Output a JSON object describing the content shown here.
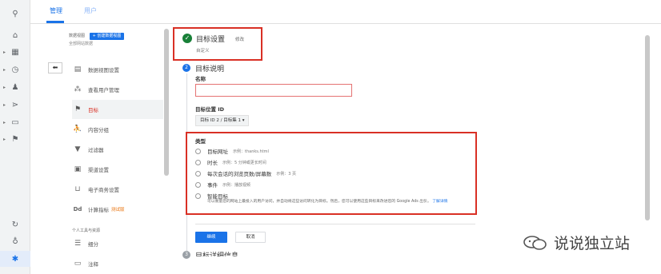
{
  "rail": {
    "items": [
      {
        "name": "search-icon",
        "glyph": "⚲"
      },
      {
        "name": "home-icon",
        "glyph": "⌂"
      },
      {
        "name": "dashboard-icon",
        "glyph": "▦"
      },
      {
        "name": "clock-icon",
        "glyph": "◷"
      },
      {
        "name": "person-icon",
        "glyph": "♟"
      },
      {
        "name": "acquisition-icon",
        "glyph": "⋗"
      },
      {
        "name": "display-icon",
        "glyph": "▭"
      },
      {
        "name": "flag-icon",
        "glyph": "⚑"
      },
      {
        "name": "share-icon",
        "glyph": "↻"
      },
      {
        "name": "lightbulb-icon",
        "glyph": "♁"
      },
      {
        "name": "gear-icon",
        "glyph": "✱"
      }
    ]
  },
  "tabs": {
    "admin": "管理",
    "users": "用户"
  },
  "admin": {
    "view_label": "数据视图",
    "create_view": "+ 创建数据视图",
    "view_sub": "全部网站数据",
    "back_glyph": "⬅",
    "menu": [
      {
        "label": "数据视图设置",
        "icon": "doc-icon",
        "glyph": "▤"
      },
      {
        "label": "查看用户管理",
        "icon": "people-icon",
        "glyph": "⁂"
      },
      {
        "label": "目标",
        "icon": "flag-icon",
        "glyph": "⚑"
      },
      {
        "label": "内容分组",
        "icon": "figure-icon",
        "glyph": "⛹"
      },
      {
        "label": "过滤器",
        "icon": "filter-icon",
        "glyph": "▼"
      },
      {
        "label": "渠道设置",
        "icon": "channel-icon",
        "glyph": "▣"
      },
      {
        "label": "电子商务设置",
        "icon": "cart-icon",
        "glyph": "🛒"
      },
      {
        "label": "计算指标",
        "icon": "dd-icon",
        "glyph": "Dd",
        "tag": "测试版"
      },
      {
        "label": "细分",
        "icon": "segment-icon",
        "glyph": "☰"
      },
      {
        "label": "注释",
        "icon": "note-icon",
        "glyph": "▭"
      }
    ],
    "section_personal": "个人工具与资源"
  },
  "goal": {
    "setup_title": "目标设置",
    "edit": "修改",
    "custom": "自定义",
    "step2_num": "2",
    "desc_title": "目标说明",
    "name_label": "名称",
    "name_value": "",
    "slot_label": "目标位置 ID",
    "slot_value": "目标 ID 2 / 目标集 1 ▾",
    "type_label": "类型",
    "types": [
      {
        "label": "目标网址",
        "example": "示例：thanks.html"
      },
      {
        "label": "时长",
        "example": "示例：5 分钟或更长时间"
      },
      {
        "label": "每次会话的浏览页数/屏幕数",
        "example": "示例：3 页"
      },
      {
        "label": "事件",
        "example": "示例：播放视频"
      },
      {
        "label": "智能目标",
        "example": ""
      }
    ],
    "smart_desc": "可以衡量您的网站上最投入的用户访问，并自动将这些访问转化为目标。然后，您可以使用这些目标来改进您的 Google Ads 出价。",
    "learn_more": "了解详情",
    "continue": "继续",
    "cancel": "取消",
    "step3_num": "3",
    "step3_title": "目标详细信息"
  },
  "watermark": "说说独立站"
}
